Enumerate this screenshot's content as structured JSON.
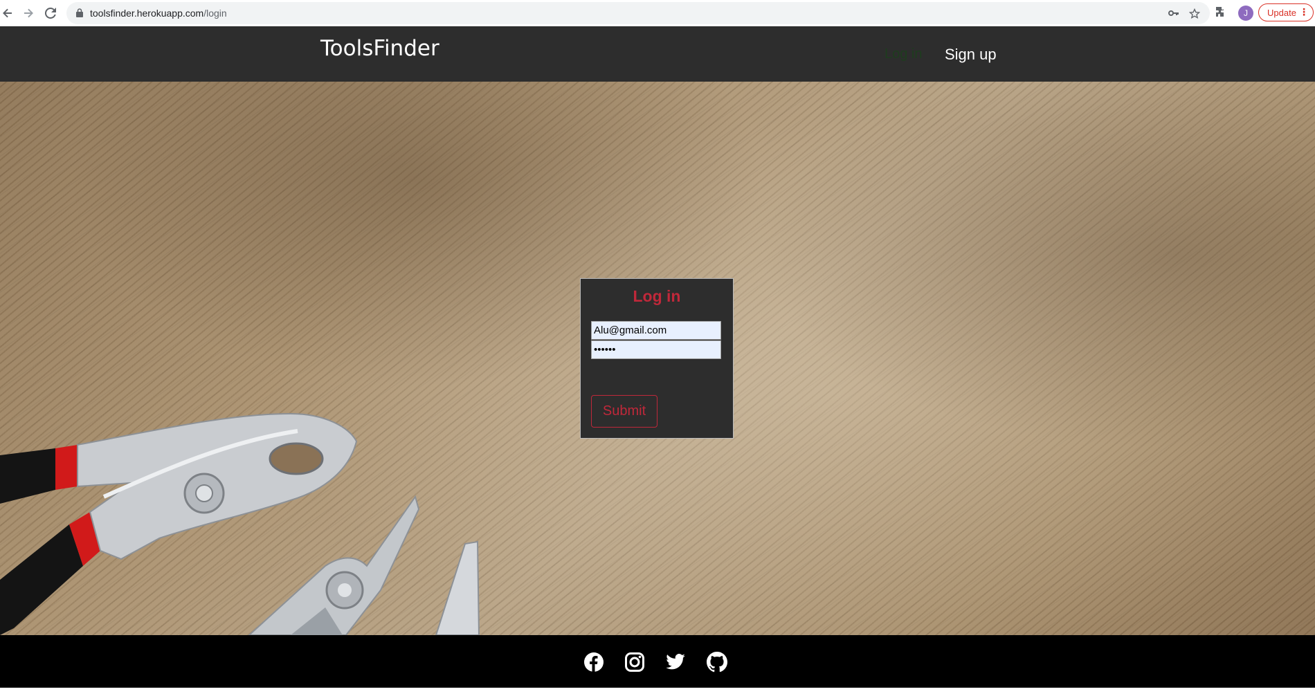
{
  "browser": {
    "url_host": "toolsfinder.herokuapp.com",
    "url_path": "/login",
    "avatar_letter": "J",
    "update_label": "Update"
  },
  "navbar": {
    "brand": "ToolsFinder",
    "login_link": "Log in",
    "signup_link": "Sign up"
  },
  "login_form": {
    "title": "Log in",
    "email_value": "Alu@gmail.com",
    "password_value": "••••••",
    "submit_label": "Submit"
  },
  "footer": {
    "social_icons": [
      "facebook-icon",
      "instagram-icon",
      "twitter-icon",
      "github-icon"
    ]
  },
  "colors": {
    "navbar_bg": "#2d2d2d",
    "accent_red": "#c0283a",
    "footer_bg": "#000000",
    "input_bg": "#e8f0fe"
  }
}
